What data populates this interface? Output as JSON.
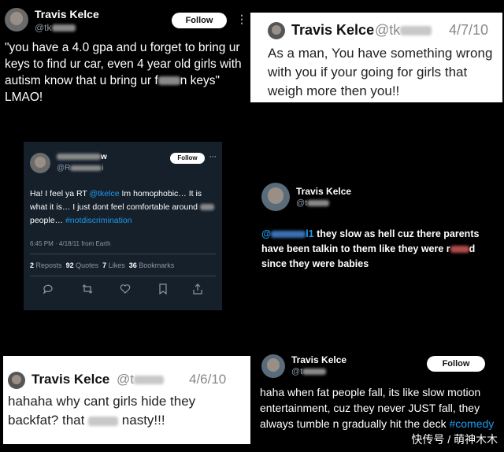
{
  "tweet1": {
    "name": "Travis Kelce",
    "handle": "@tk",
    "follow": "Follow",
    "more": "⋮",
    "text": "\"you have a 4.0 gpa and u forget to bring ur keys to find ur car, even 4 year old girls with autism know that u bring ur f",
    "text_end": "n keys\" LMAO!"
  },
  "tweet2": {
    "name": "Travis Kelce",
    "handle": "@tk",
    "date": "4/7/10",
    "text": "As a man, You have something wrong with you if your going for girls that weigh more then you!!"
  },
  "tweet3": {
    "name_end": "w",
    "handle": "@R",
    "handle_end": "i",
    "follow": "Follow",
    "more": "···",
    "text_a": "Ha! I feel ya RT ",
    "mention": "@tkelce",
    "text_b": " Im homophobic… It is what it is… I just dont feel comfortable around ",
    "text_c": "people… ",
    "hashtag": "#notdiscrimination",
    "meta": "6:45 PM · 4/18/11 from Earth",
    "stats": [
      {
        "num": "2",
        "label": "Reposts"
      },
      {
        "num": "92",
        "label": "Quotes"
      },
      {
        "num": "7",
        "label": "Likes"
      },
      {
        "num": "36",
        "label": "Bookmarks"
      }
    ]
  },
  "tweet4": {
    "name": "Travis Kelce",
    "handle": "@t",
    "mention_start": "@",
    "mention_end": "l1",
    "text_a": " they slow as hell cuz there parents have been talkin to them like they were r",
    "text_b": "d since they were babies"
  },
  "tweet5": {
    "name": "Travis Kelce",
    "handle": "@t",
    "date": "4/6/10",
    "text_a": "hahaha why cant girls hide they backfat? that ",
    "text_b": " nasty!!!"
  },
  "tweet6": {
    "name": "Travis Kelce",
    "handle": "@t",
    "follow": "Follow",
    "text": "haha when fat people fall, its like slow motion entertainment, cuz they never JUST fall, they always tumble n gradually hit the deck ",
    "hashtag": "#comedy"
  },
  "watermark": "快传号 / 萌神木木"
}
